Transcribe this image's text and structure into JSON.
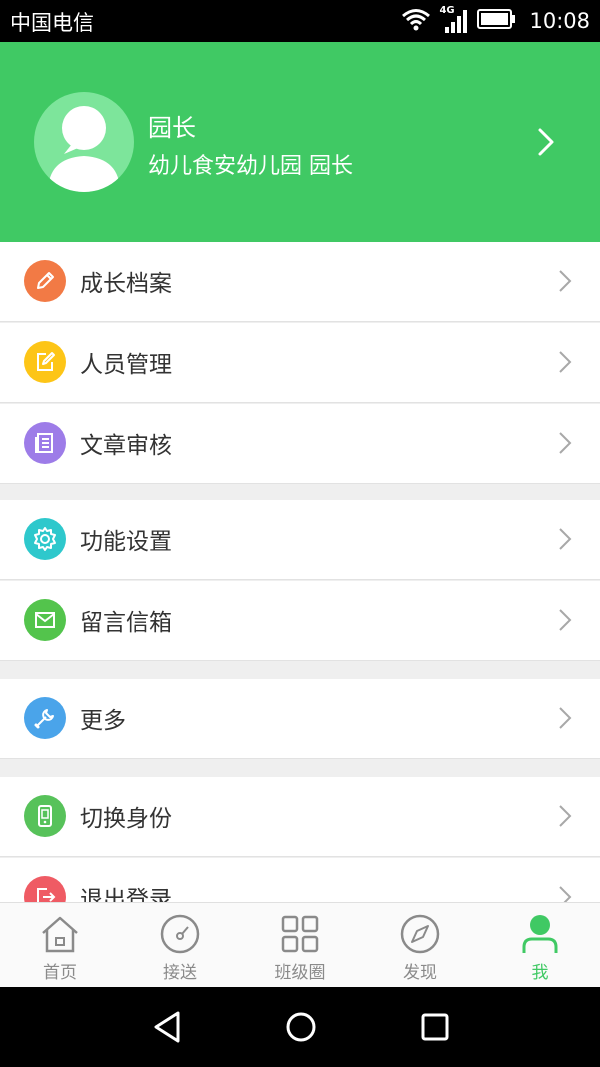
{
  "status_bar": {
    "carrier": "中国电信",
    "network": "4G",
    "time": "10:08"
  },
  "profile": {
    "name": "园长",
    "subtitle": "幼儿食安幼儿园 园长"
  },
  "menu": [
    {
      "label": "成长档案",
      "icon": "pencil-icon",
      "color": "#f27a45"
    },
    {
      "label": "人员管理",
      "icon": "edit-icon",
      "color": "#fdc517"
    },
    {
      "label": "文章审核",
      "icon": "document-icon",
      "color": "#9d7ce8"
    },
    {
      "label": "功能设置",
      "icon": "gear-icon",
      "color": "#2ec8cc"
    },
    {
      "label": "留言信箱",
      "icon": "mail-icon",
      "color": "#53c44c"
    },
    {
      "label": "更多",
      "icon": "wrench-icon",
      "color": "#4aa4ea"
    },
    {
      "label": "切换身份",
      "icon": "phone-icon",
      "color": "#57c25a"
    },
    {
      "label": "退出登录",
      "icon": "logout-icon",
      "color": "#ef5b64"
    }
  ],
  "tabs": [
    {
      "label": "首页",
      "icon": "home-icon"
    },
    {
      "label": "接送",
      "icon": "dial-icon"
    },
    {
      "label": "班级圈",
      "icon": "grid-icon"
    },
    {
      "label": "发现",
      "icon": "compass-icon"
    },
    {
      "label": "我",
      "icon": "person-icon",
      "active": true
    }
  ],
  "colors": {
    "accent": "#40c964",
    "header_bg": "#40c964",
    "tab_inactive": "#8a8a8a"
  }
}
